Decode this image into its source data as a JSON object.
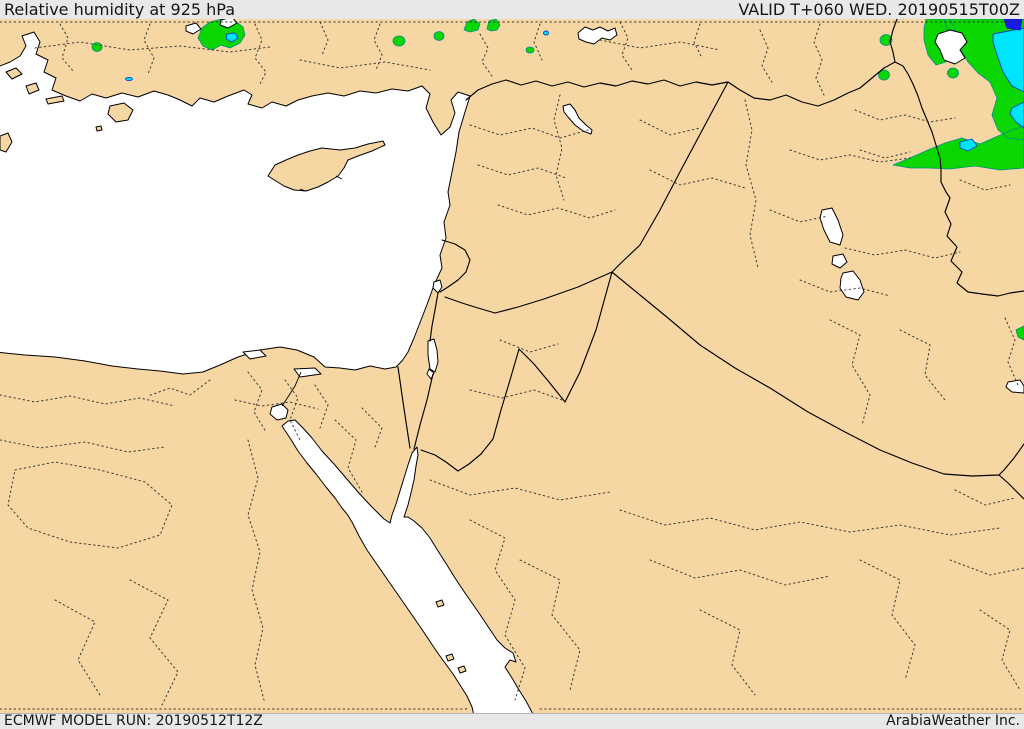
{
  "header": {
    "title": "Relative humidity at 925 hPa",
    "valid_label": "VALID T+060 WED. 20190515T00Z"
  },
  "footer": {
    "model_run": "ECMWF MODEL RUN: 20190512T12Z",
    "credit": "ArabiaWeather Inc."
  },
  "map": {
    "model": "ECMWF",
    "parameter": "Relative humidity",
    "level_hpa": 925,
    "forecast_hour": "T+060",
    "valid_time": "20190515T00Z",
    "run_time": "20190512T12Z",
    "colors": {
      "land": "#f6d7a3",
      "sea": "#ffffff",
      "coast_line": "#000000",
      "country_border": "#000000",
      "admin_boundary": "#2b2b2b",
      "humidity_green": "#0cd600",
      "humidity_cyan": "#00e5ff",
      "humidity_blue": "#1a1aef",
      "bar_background": "#e8e8e8",
      "text": "#151515"
    }
  }
}
